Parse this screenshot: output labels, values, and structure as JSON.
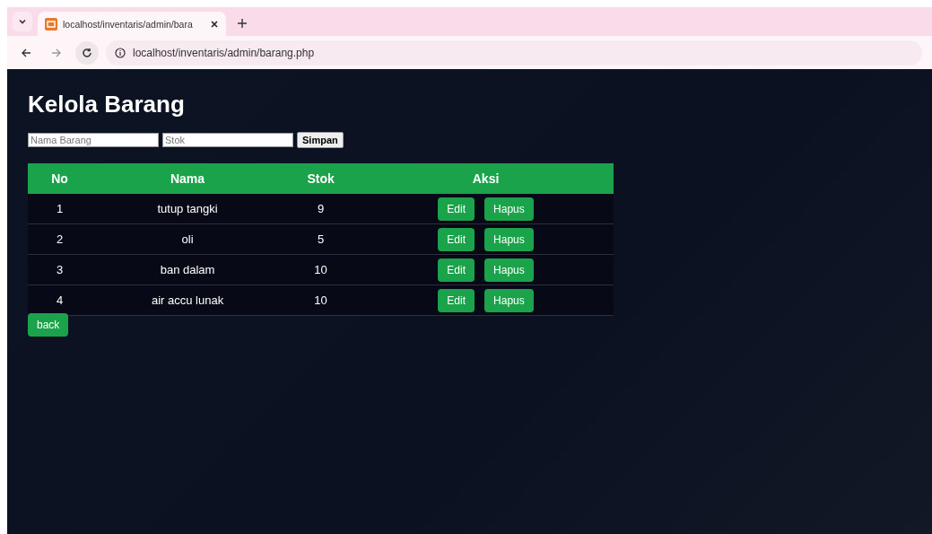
{
  "browser": {
    "tab": {
      "title": "localhost/inventaris/admin/bara",
      "selected": true
    },
    "url": "localhost/inventaris/admin/barang.php"
  },
  "page": {
    "title": "Kelola Barang",
    "form": {
      "fields": [
        {
          "placeholder": "Nama Barang"
        },
        {
          "placeholder": "Stok"
        }
      ],
      "submit": "Simpan"
    },
    "table": {
      "columns": [
        "No",
        "Nama",
        "Stok",
        "Aksi"
      ],
      "rows": [
        {
          "no": "1",
          "nama": "tutup tangki",
          "stok": "9",
          "actions": [
            "Edit",
            "Hapus"
          ]
        },
        {
          "no": "2",
          "nama": "oli",
          "stok": "5",
          "actions": [
            "Edit",
            "Hapus"
          ]
        },
        {
          "no": "3",
          "nama": "ban dalam",
          "stok": "10",
          "actions": [
            "Edit",
            "Hapus"
          ]
        },
        {
          "no": "4",
          "nama": "air accu lunak",
          "stok": "10",
          "actions": [
            "Edit",
            "Hapus"
          ]
        }
      ]
    },
    "back_button": "back"
  }
}
